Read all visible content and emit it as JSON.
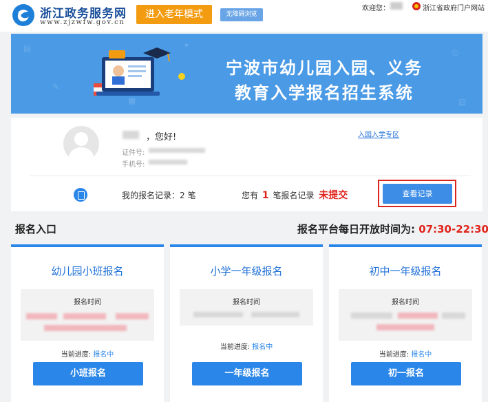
{
  "header": {
    "site_name": "浙江政务服务网",
    "site_url": "www.zjzwfw.gov.cn",
    "elder_mode_label": "进入老年模式",
    "barrier_free_label": "无障碍浏览",
    "welcome_label": "欢迎您：",
    "portal_link": "浙江省政府门户网站"
  },
  "banner": {
    "title_line1": "宁波市幼儿园入园、义务",
    "title_line2": "教育入学报名招生系统"
  },
  "user": {
    "greeting": "，您好!",
    "id_label": "证件号:",
    "phone_label": "手机号:",
    "special_link": "入园入学专区",
    "record_label": "我的报名记录：2 笔",
    "pending_prefix": "您有",
    "pending_count": "1",
    "pending_middle": "笔报名记录",
    "pending_status": "未提交",
    "view_button": "查看记录"
  },
  "entry": {
    "section_title": "报名入口",
    "hours_label": "报名平台每日开放时间为:",
    "hours_value": "07:30-22:30"
  },
  "cards": [
    {
      "title": "幼儿园小班报名",
      "time_label": "报名时间",
      "progress_label": "当前进度:",
      "progress_status": "报名中",
      "button": "小班报名"
    },
    {
      "title": "小学一年级报名",
      "time_label": "报名时间",
      "progress_label": "当前进度:",
      "progress_status": "报名中",
      "button": "一年级报名"
    },
    {
      "title": "初中一年级报名",
      "time_label": "报名时间",
      "progress_label": "当前进度:",
      "progress_status": "报名中",
      "button": "初一报名"
    }
  ],
  "colors": {
    "accent": "#2a86e8",
    "banner": "#4a9ae6",
    "alert": "#e0241c",
    "elder_mode": "#f39c12"
  },
  "icons": [
    "app-logo-icon",
    "gov-emblem-icon",
    "avatar-placeholder",
    "record-list-icon"
  ]
}
